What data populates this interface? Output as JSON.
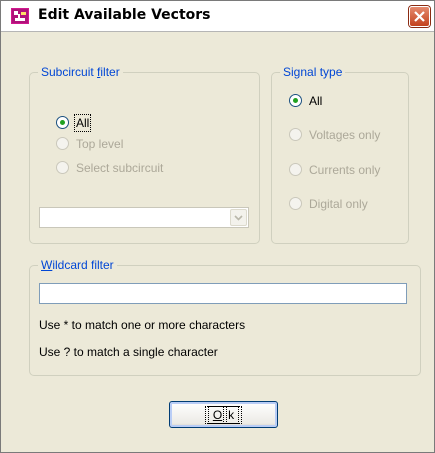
{
  "window": {
    "title": "Edit Available Vectors"
  },
  "subcircuit_filter": {
    "legend_prefix": "Subcircuit ",
    "legend_underlined": "f",
    "legend_suffix": "ilter",
    "options": [
      {
        "label": "All",
        "selected": true,
        "enabled": true
      },
      {
        "label": "Top level",
        "selected": false,
        "enabled": false
      },
      {
        "label": "Select subcircuit",
        "selected": false,
        "enabled": false
      }
    ],
    "subcircuit_value": ""
  },
  "signal_type": {
    "legend": "Signal type",
    "options": [
      {
        "label": "All",
        "selected": true,
        "enabled": true
      },
      {
        "label": "Voltages only",
        "selected": false,
        "enabled": false
      },
      {
        "label": "Currents only",
        "selected": false,
        "enabled": false
      },
      {
        "label": "Digital only",
        "selected": false,
        "enabled": false
      }
    ]
  },
  "wildcard_filter": {
    "legend_underlined": "W",
    "legend_suffix": "ildcard filter",
    "value": "",
    "help_1": "Use * to match one or more characters",
    "help_2": "Use ? to match a single character"
  },
  "ok_button": {
    "underlined": "O",
    "rest": "k"
  },
  "colors": {
    "legend_text": "#0046d5",
    "dialog_bg": "#ece9d8",
    "close_button": "#c3411c"
  }
}
